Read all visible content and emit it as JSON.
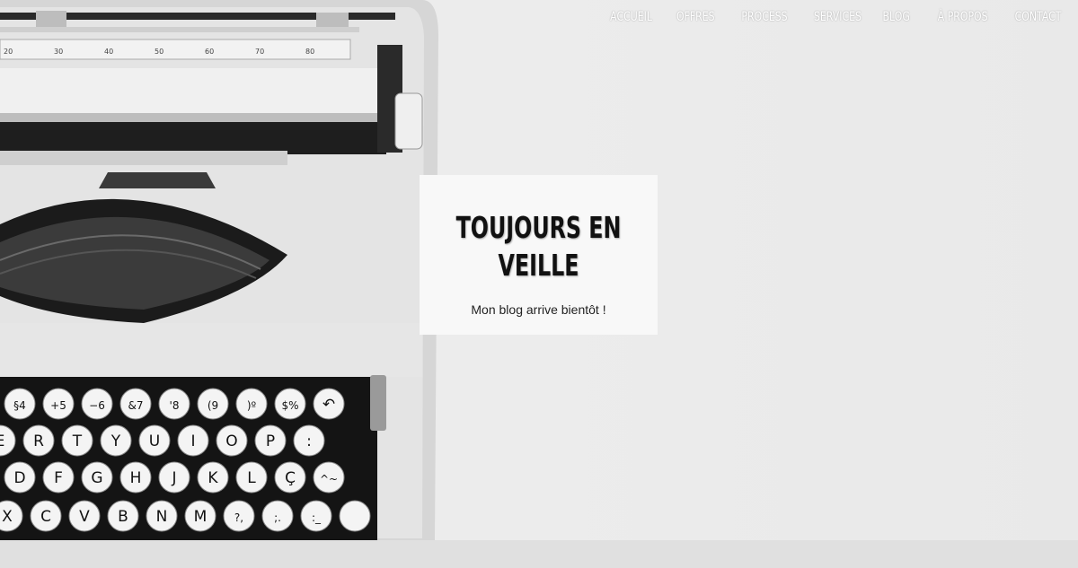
{
  "nav": {
    "items": [
      {
        "label": "ACCUEIL"
      },
      {
        "label": "OFFRES"
      },
      {
        "label": "PROCESS"
      },
      {
        "label": "SERVICES"
      },
      {
        "label": "BLOG"
      },
      {
        "label": "À PROPOS"
      },
      {
        "label": "CONTACT"
      }
    ]
  },
  "card": {
    "title": "TOUJOURS EN VEILLE",
    "subtitle": "Mon blog arrive bientôt !"
  },
  "typewriter": {
    "ruler_numbers": [
      "20",
      "30",
      "40",
      "50",
      "60",
      "70",
      "80"
    ],
    "key_rows": [
      [
        "§4",
        "+5",
        "−6",
        "&7",
        "'8",
        "(9",
        ")º",
        "$%",
        "↶"
      ],
      [
        "E",
        "R",
        "T",
        "Y",
        "U",
        "I",
        "O",
        "P",
        ":"
      ],
      [
        "D",
        "F",
        "G",
        "H",
        "J",
        "K",
        "L",
        "Ç",
        "^~"
      ],
      [
        "X",
        "C",
        "V",
        "B",
        "N",
        "M",
        "?,",
        ";.",
        ":_",
        ""
      ]
    ]
  },
  "colors": {
    "background": "#eeeeee",
    "card": "#f8f8f8",
    "nav_text": "#ffffff",
    "title_text": "#111111"
  }
}
